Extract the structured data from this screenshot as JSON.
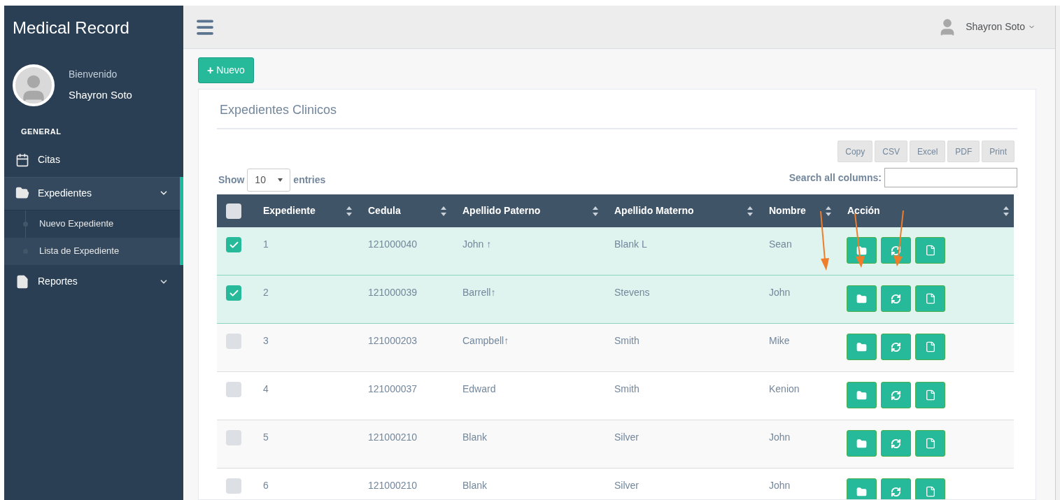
{
  "sidebar": {
    "title": "Medical Record",
    "user": {
      "greeting": "Bienvenido",
      "name": "Shayron Soto"
    },
    "section": "GENERAL",
    "items": [
      {
        "label": "Citas",
        "kind": "link",
        "selected": false
      },
      {
        "label": "Expedientes",
        "kind": "menu",
        "selected": true,
        "expanded": true,
        "children": [
          {
            "label": "Nuevo Expediente",
            "selected": false
          },
          {
            "label": "Lista de Expediente",
            "selected": true
          }
        ]
      },
      {
        "label": "Reportes",
        "kind": "menu",
        "selected": false,
        "expanded": false
      }
    ]
  },
  "top_bar": {
    "user_name": "Shayron Soto"
  },
  "new_button": {
    "icon_text": "+",
    "label": "Nuevo"
  },
  "panel": {
    "title": "Expedientes Clinicos",
    "export_buttons": [
      "Copy",
      "CSV",
      "Excel",
      "PDF",
      "Print"
    ],
    "length": {
      "label_before": "Show",
      "value": "10",
      "label_after": "entries"
    },
    "search": {
      "label": "Search all columns:"
    },
    "table": {
      "select_all_checked": false,
      "columns": [
        "Expediente",
        "Cedula",
        "Apellido Paterno",
        "Apellido Materno",
        "Nombre",
        "Acción"
      ],
      "rows": [
        {
          "selected": true,
          "cells": [
            "1",
            "121000040",
            "John ↑",
            "Blank L",
            "Sean"
          ]
        },
        {
          "selected": true,
          "cells": [
            "2",
            "121000039",
            "Barrell↑",
            "Stevens",
            "John"
          ]
        },
        {
          "selected": false,
          "cells": [
            "3",
            "121000203",
            "Campbell↑",
            "Smith",
            "Mike"
          ]
        },
        {
          "selected": false,
          "cells": [
            "4",
            "121000037",
            "Edward",
            "Smith",
            "Kenion"
          ]
        },
        {
          "selected": false,
          "cells": [
            "5",
            "121000210",
            "Blank",
            "Silver",
            "John"
          ]
        },
        {
          "selected": false,
          "cells": [
            "6",
            "121000210",
            "Blank",
            "Silver",
            "John"
          ]
        }
      ]
    }
  }
}
